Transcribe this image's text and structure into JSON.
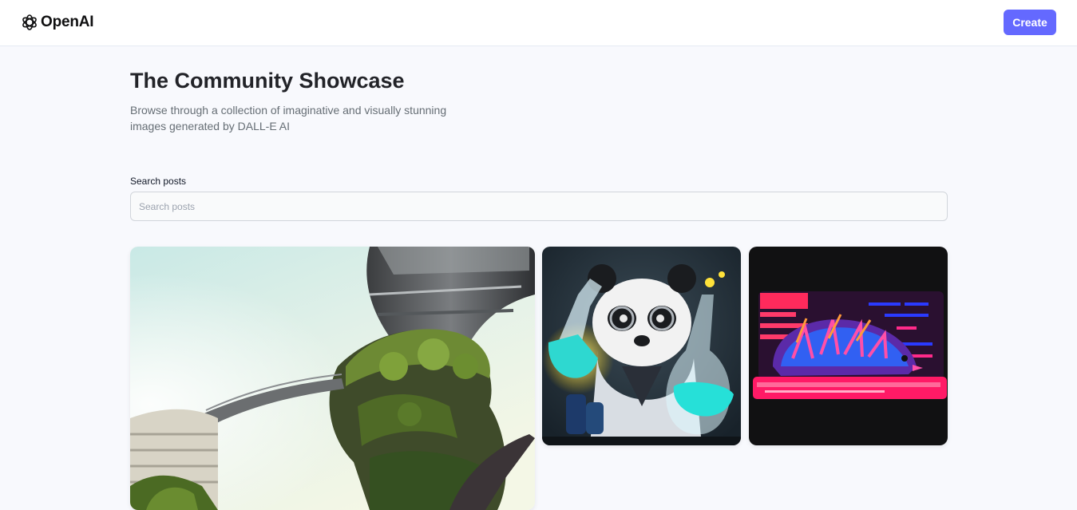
{
  "header": {
    "logo_text": "OpenAI",
    "create_label": "Create"
  },
  "main": {
    "title": "The Community Showcase",
    "subtitle": "Browse through a collection of imaginative and visually stunning images generated by DALL-E AI",
    "search": {
      "label": "Search posts",
      "placeholder": "Search posts",
      "value": ""
    }
  },
  "colors": {
    "accent": "#6469ff",
    "background": "#f8f9fd",
    "title": "#222328",
    "subtitle": "#666e75"
  },
  "posts": [
    {
      "kind": "image",
      "icon": "futuristic-city-image"
    },
    {
      "kind": "image",
      "icon": "panda-scientist-image"
    },
    {
      "kind": "image",
      "icon": "neon-hedgehog-image"
    }
  ]
}
